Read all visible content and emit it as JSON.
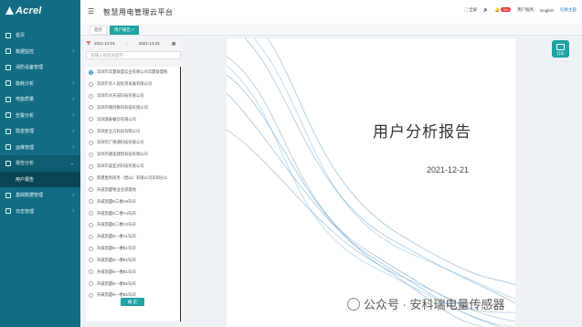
{
  "brand": {
    "logo_text": "Acrel"
  },
  "header": {
    "system_title": "智慧用电管理云平台",
    "fullscreen_label": "全屏",
    "badge_count": "99+",
    "customer_service": "用户服务",
    "language": "English",
    "user_link": "切换主题"
  },
  "sidebar": {
    "items": [
      {
        "label": "首页",
        "chevron": ""
      },
      {
        "label": "数据监控",
        "chevron": "›"
      },
      {
        "label": "消防设备管理",
        "chevron": ""
      },
      {
        "label": "能耗分析",
        "chevron": "›"
      },
      {
        "label": "电能质量",
        "chevron": "›"
      },
      {
        "label": "告警分析",
        "chevron": "›"
      },
      {
        "label": "隐患管理",
        "chevron": "›"
      },
      {
        "label": "运维管理",
        "chevron": "›"
      },
      {
        "label": "报告分析",
        "chevron": "⌄"
      },
      {
        "label": "用户报告",
        "chevron": ""
      },
      {
        "label": "基础数据管理",
        "chevron": "›"
      },
      {
        "label": "日志管理",
        "chevron": "›"
      }
    ]
  },
  "tabs": [
    {
      "label": "首页"
    },
    {
      "label": "用户报告 ×"
    }
  ],
  "filter": {
    "start_date": "2021-12-01",
    "separator": "-",
    "end_date": "2021-12-21",
    "search_placeholder": "请输入搜索关键字",
    "confirm_label": "确 定"
  },
  "companies": [
    {
      "name": "深圳市华夏联盟实业有限公司华夏联盟购",
      "checked": true
    },
    {
      "name": "深圳市名人居投资发展有限公司",
      "checked": false
    },
    {
      "name": "深圳市众天成科技有限公司",
      "checked": false
    },
    {
      "name": "深圳市德同数码科技有限公司",
      "checked": false
    },
    {
      "name": "深圳源泰餐饮有限公司",
      "checked": false
    },
    {
      "name": "深圳金立方科技有限公司",
      "checked": false
    },
    {
      "name": "深圳市广德通科技有限公司",
      "checked": false
    },
    {
      "name": "深圳市捷美建筑科技有限公司",
      "checked": false
    },
    {
      "name": "深圳市美亚达科技有限公司",
      "checked": false
    },
    {
      "name": "新建胜利商务（昆山）有限公司深圳分公",
      "checked": false
    },
    {
      "name": "升威凯厦物业总部基地",
      "checked": false
    },
    {
      "name": "升威凯厦B三楼A9车间",
      "checked": false
    },
    {
      "name": "升威凯厦B二楼A4车间",
      "checked": false
    },
    {
      "name": "升威凯厦B二楼A3车间",
      "checked": false
    },
    {
      "name": "升威凯厦B一楼A1车间",
      "checked": false
    },
    {
      "name": "升威凯厦B一楼B1车间",
      "checked": false
    },
    {
      "name": "升威凯厦B一楼B2车间",
      "checked": false
    },
    {
      "name": "升威凯厦B一楼B1车间",
      "checked": false
    },
    {
      "name": "升威凯厦B一楼B5车间",
      "checked": false
    },
    {
      "name": "升威凯厦B一楼B5车间",
      "checked": false
    }
  ],
  "report": {
    "title": "用户分析报告",
    "date": "2021-12-21",
    "print_label": "打印"
  },
  "watermark": {
    "text": "公众号 · 安科瑞电量传感器"
  },
  "colors": {
    "sidebar": "#126d84",
    "accent": "#1fa3a3",
    "link": "#2a7ac9"
  }
}
